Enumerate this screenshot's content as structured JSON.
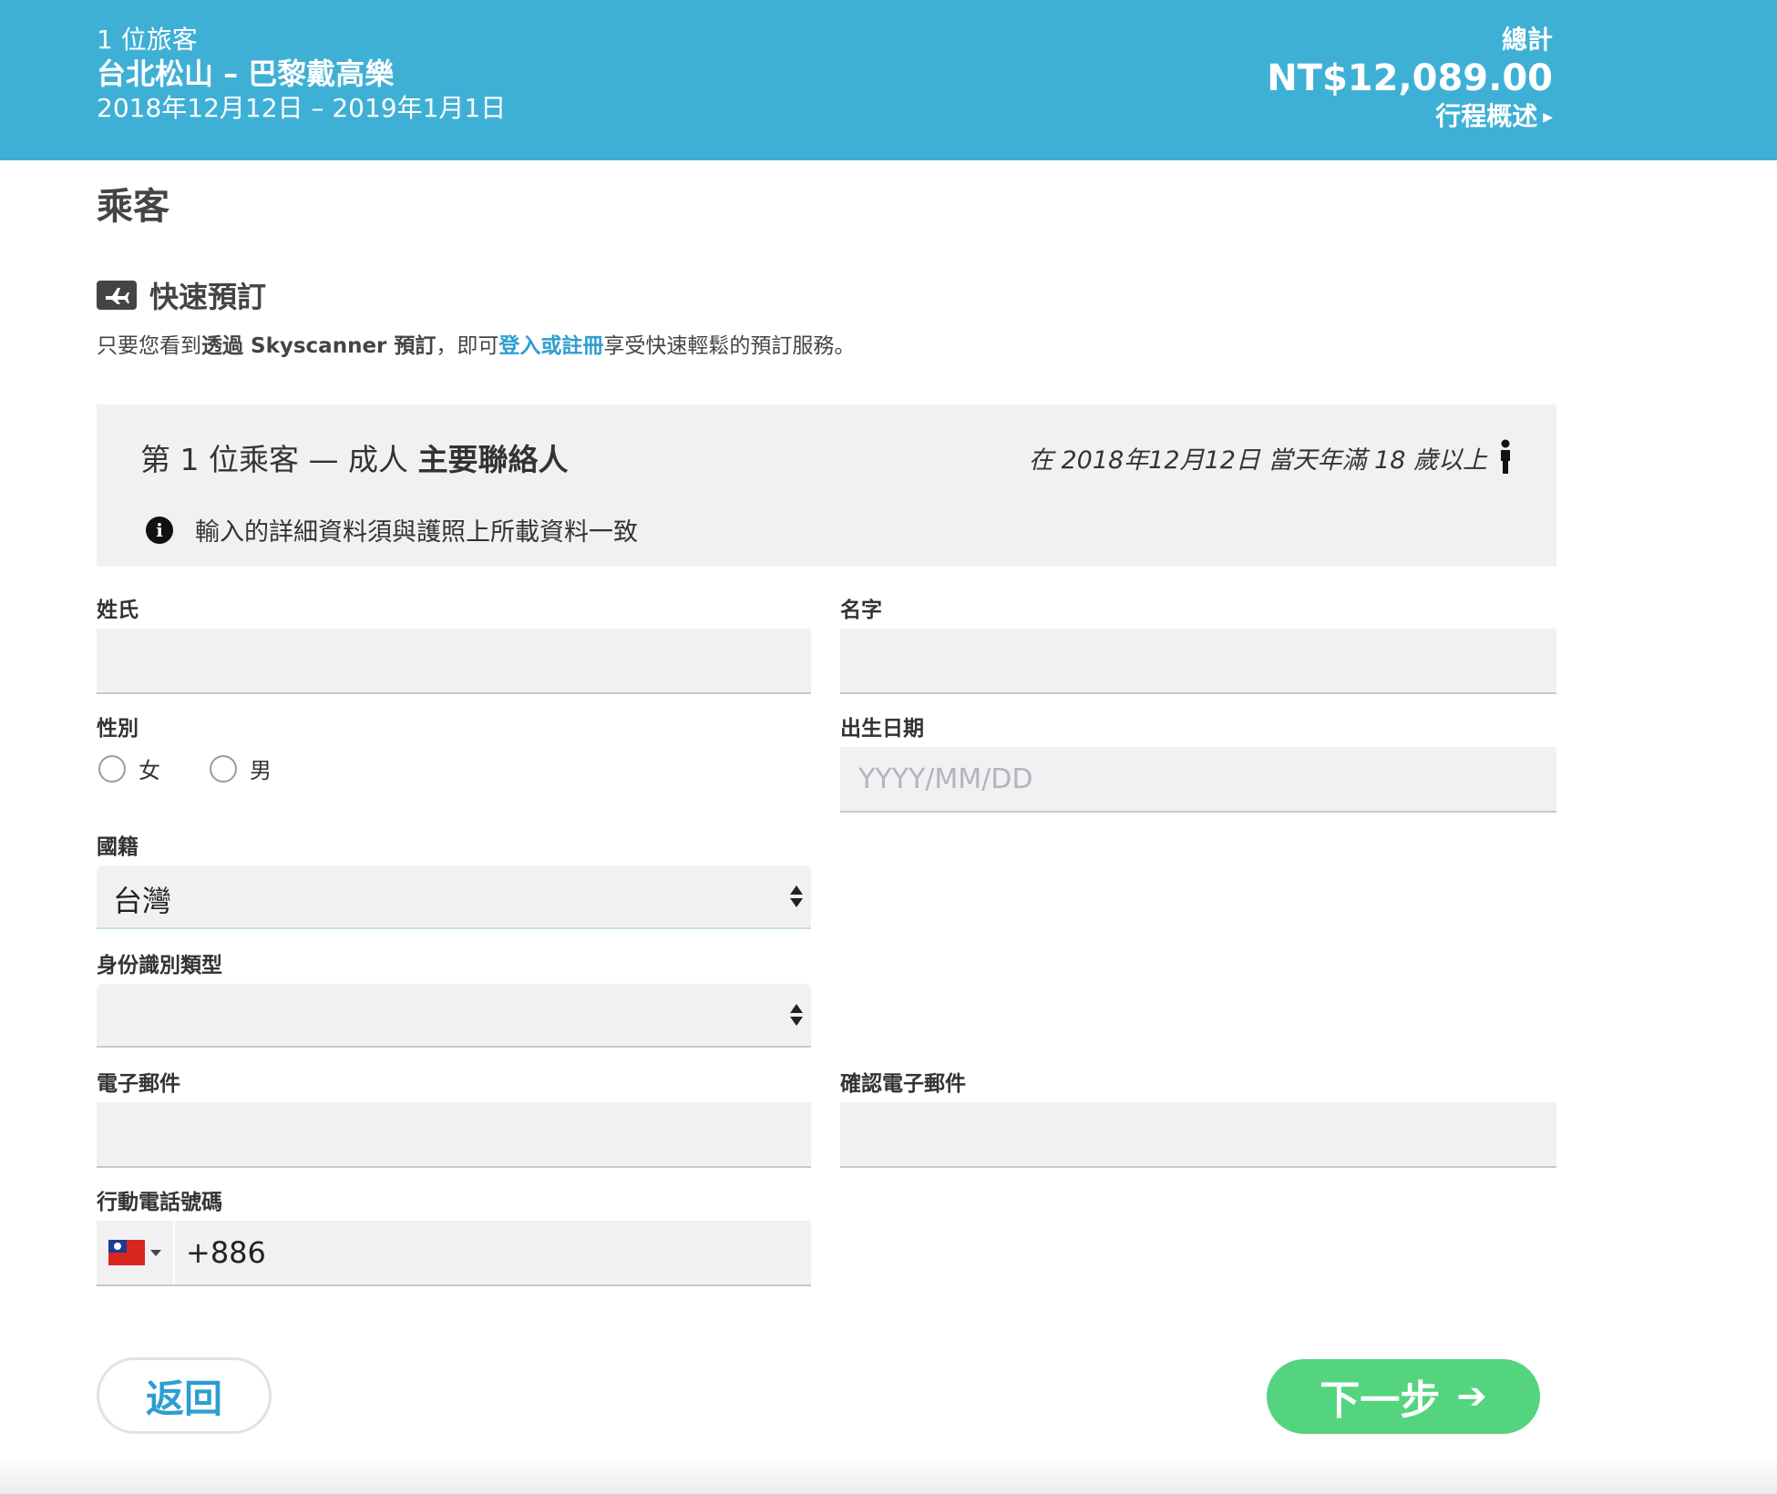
{
  "header": {
    "travelers": "1 位旅客",
    "route": "台北松山 – 巴黎戴高樂",
    "dates": "2018年12月12日 – 2019年1月1日",
    "total_label": "總計",
    "price": "NT$12,089.00",
    "summary_link": "行程概述"
  },
  "page": {
    "section_title": "乘客"
  },
  "quick_booking": {
    "title": "快速預訂",
    "desc_prefix": "只要您看到",
    "desc_bold": "透過 Skyscanner 預訂",
    "desc_mid": "，即可",
    "desc_link": "登入或註冊",
    "desc_suffix": "享受快速輕鬆的預訂服務。"
  },
  "passenger": {
    "title_prefix": "第 1 位乘客 — 成人 ",
    "title_bold": "主要聯絡人",
    "age_note": "在 2018年12月12日 當天年滿 18 歲以上",
    "info_note": "輸入的詳細資料須與護照上所載資料一致"
  },
  "form": {
    "last_name_label": "姓氏",
    "first_name_label": "名字",
    "gender_label": "性別",
    "gender_options": [
      "女",
      "男"
    ],
    "dob_label": "出生日期",
    "dob_placeholder": "YYYY/MM/DD",
    "nationality_label": "國籍",
    "nationality_value": "台灣",
    "id_type_label": "身份識別類型",
    "id_type_value": "",
    "email_label": "電子郵件",
    "confirm_email_label": "確認電子郵件",
    "phone_label": "行動電話號碼",
    "phone_code": "+886"
  },
  "buttons": {
    "back": "返回",
    "next": "下一步"
  },
  "colors": {
    "header_bg": "#3fb0d5",
    "link": "#2e9ed0",
    "next_button": "#55d47f"
  }
}
